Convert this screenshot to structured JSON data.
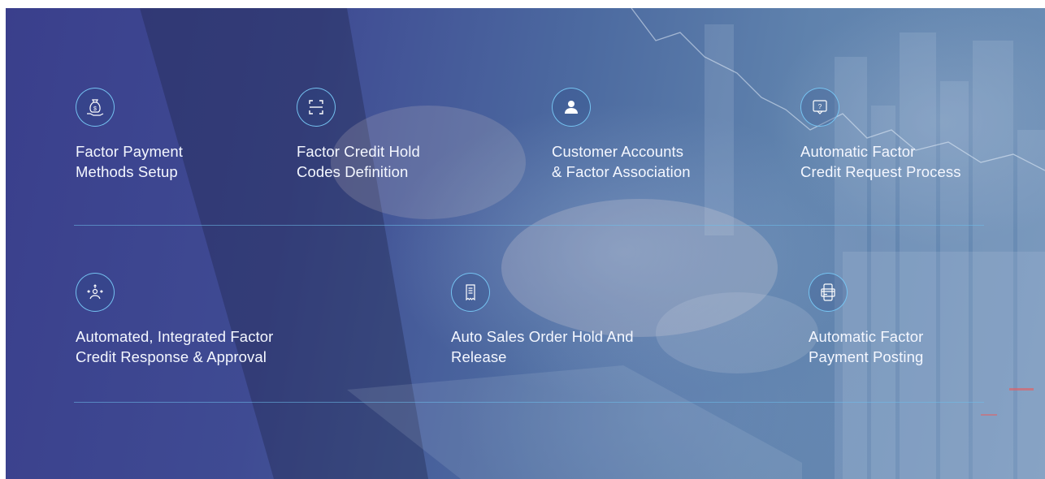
{
  "features_row1": [
    {
      "title": "Factor Payment\nMethods Setup",
      "icon": "money-bag-hand-icon"
    },
    {
      "title": "Factor Credit Hold\nCodes Definition",
      "icon": "code-scan-icon"
    },
    {
      "title": "Customer Accounts\n& Factor Association",
      "icon": "user-icon"
    },
    {
      "title": "Automatic Factor\nCredit Request Process",
      "icon": "question-chat-icon"
    }
  ],
  "features_row2": [
    {
      "title": "Automated, Integrated Factor\nCredit Response & Approval",
      "icon": "person-approval-icon"
    },
    {
      "title": "Auto Sales Order Hold And\nRelease",
      "icon": "receipt-icon"
    },
    {
      "title": "Automatic Factor\nPayment Posting",
      "icon": "mobile-card-payment-icon"
    }
  ],
  "colors": {
    "accent_line": "#6ebeeb",
    "icon_stroke": "#78c8f5",
    "background_start": "#3a3f8c",
    "background_end": "#6d8fb6",
    "text": "#ffffff"
  }
}
